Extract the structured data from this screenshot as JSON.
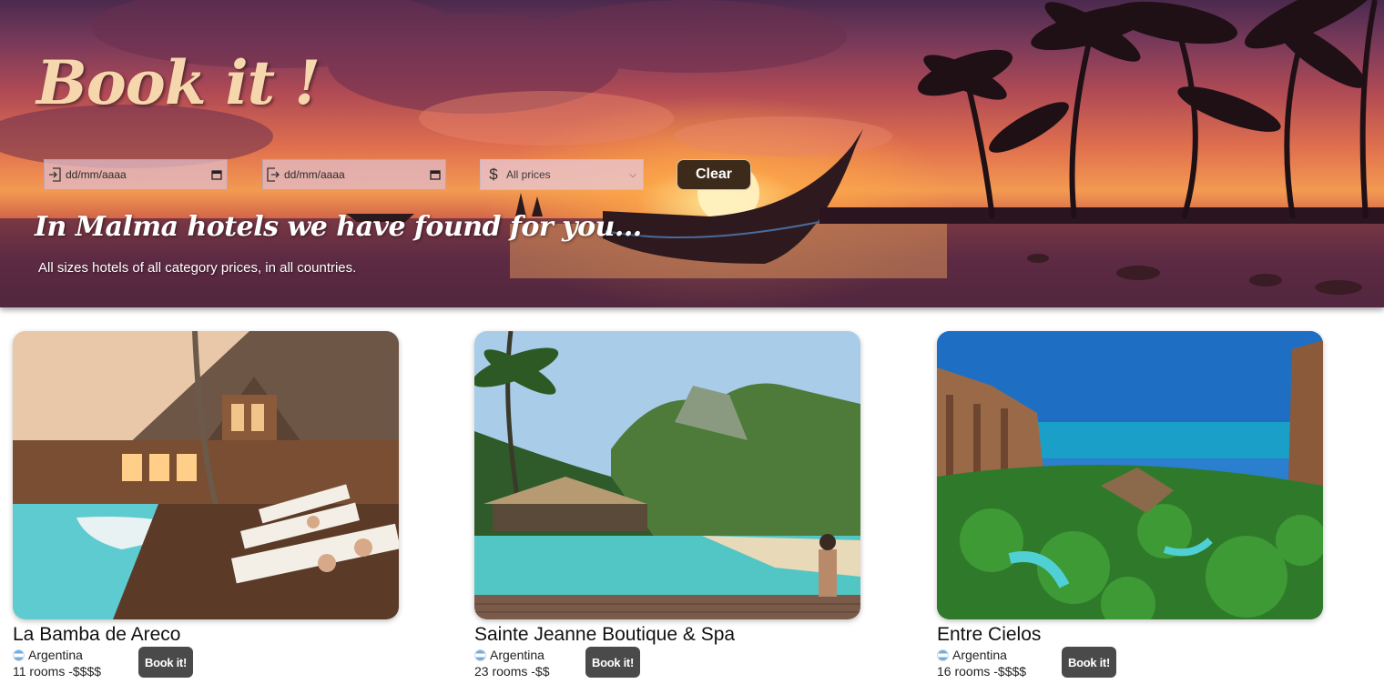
{
  "brand": {
    "title": "Book it !"
  },
  "search": {
    "checkin": {
      "placeholder": "dd/mm/aaaa",
      "icon": "login-icon"
    },
    "checkout": {
      "placeholder": "dd/mm/aaaa",
      "icon": "logout-icon"
    },
    "price": {
      "selected": "All prices",
      "icon": "dollar-icon"
    },
    "clear_label": "Clear"
  },
  "hero": {
    "tagline": "In Malma hotels we have found for you...",
    "subtitle": "All sizes hotels of all category prices, in all countries."
  },
  "hotels": [
    {
      "name": "La Bamba de Areco",
      "country": "Argentina",
      "rooms": "11 rooms -$$$$",
      "book_label": "Book it!"
    },
    {
      "name": "Sainte Jeanne Boutique & Spa",
      "country": "Argentina",
      "rooms": "23 rooms -$$",
      "book_label": "Book it!"
    },
    {
      "name": "Entre Cielos",
      "country": "Argentina",
      "rooms": "16 rooms -$$$$",
      "book_label": "Book it!"
    }
  ]
}
